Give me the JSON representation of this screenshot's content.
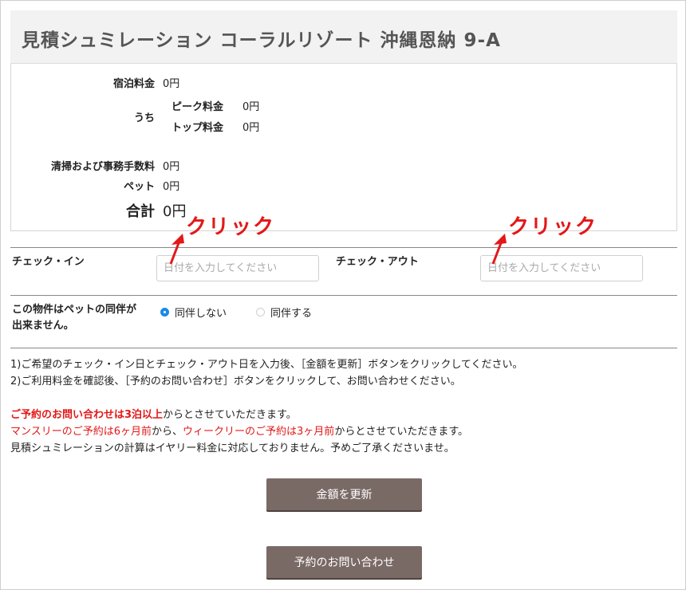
{
  "title": "見積シュミレーション コーラルリゾート 沖縄恩納 9-A",
  "prices": {
    "stay_label": "宿泊料金",
    "stay_value": "0円",
    "breakdown_label": "うち",
    "peak_label": "ピーク料金",
    "peak_value": "0円",
    "top_label": "トップ料金",
    "top_value": "0円",
    "cleaning_label": "清掃および事務手数料",
    "cleaning_value": "0円",
    "pet_label": "ペット",
    "pet_value": "0円",
    "total_label": "合計",
    "total_value": "0円"
  },
  "annotations": {
    "click_left": "クリック",
    "click_right": "クリック",
    "color": "#e31818"
  },
  "checkin": {
    "label": "チェック・イン",
    "placeholder": "日付を入力してください"
  },
  "checkout": {
    "label": "チェック・アウト",
    "placeholder": "日付を入力してください"
  },
  "pet": {
    "label_line1": "この物件はペットの同伴が",
    "label_line2": "出来ません。",
    "options": [
      "同伴しない",
      "同伴する"
    ],
    "selected": "同伴しない"
  },
  "notes": {
    "line1": "1)ご希望のチェック・イン日とチェック・アウト日を入力後、［金額を更新］ボタンをクリックしてください。",
    "line2": "2)ご利用料金を確認後、［予約のお問い合わせ］ボタンをクリックして、お問い合わせください。",
    "line3_red_bold": "ご予約のお問い合わせは3泊以上",
    "line3_rest": "からとさせていただきます。",
    "line4_red1": "マンスリーのご予約は6ヶ月前",
    "line4_mid": "から、",
    "line4_red2": "ウィークリーのご予約は3ヶ月前",
    "line4_rest": "からとさせていただきます。",
    "line5": "見積シュミレーションの計算はイヤリー料金に対応しておりません。予めご了承くださいませ。"
  },
  "buttons": {
    "update": "金額を更新",
    "inquiry": "予約のお問い合わせ"
  },
  "colors": {
    "button_bg": "#7a6a66",
    "radio_selected": "#1a8be6",
    "emphasis": "#e31818"
  }
}
